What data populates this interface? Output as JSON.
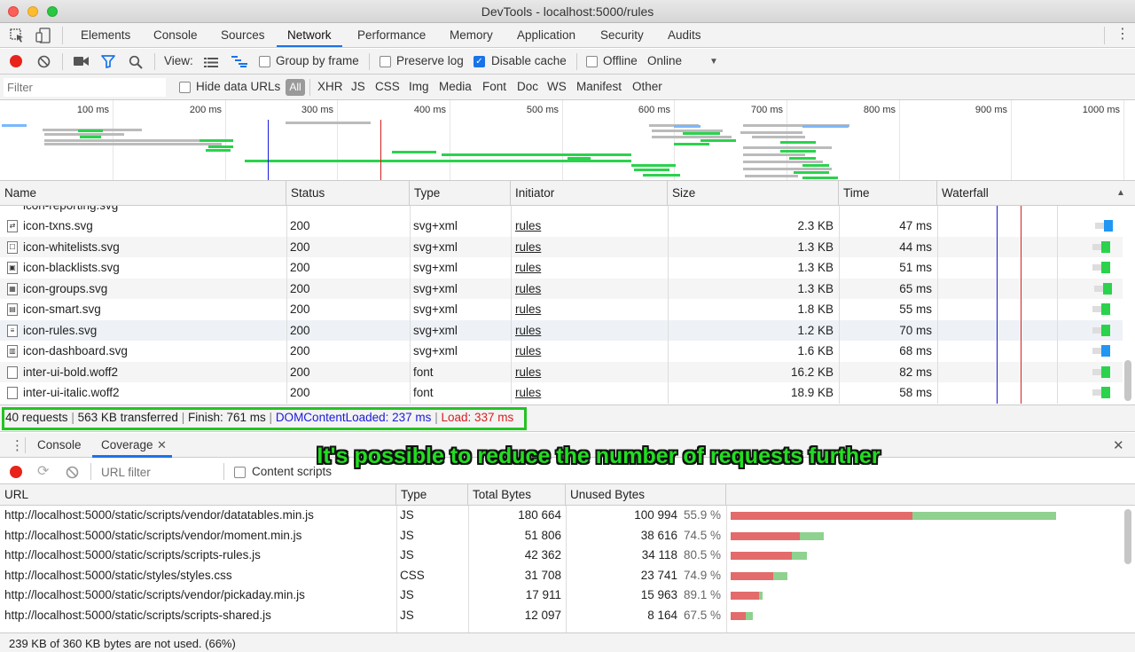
{
  "window": {
    "title": "DevTools - localhost:5000/rules"
  },
  "tabs": [
    "Elements",
    "Console",
    "Sources",
    "Network",
    "Performance",
    "Memory",
    "Application",
    "Security",
    "Audits"
  ],
  "toolbar": {
    "view_label": "View:",
    "group_by_frame": "Group by frame",
    "preserve_log": "Preserve log",
    "disable_cache": "Disable cache",
    "offline": "Offline",
    "throttle_value": "Online"
  },
  "filterbar": {
    "filter_placeholder": "Filter",
    "hide_data_urls": "Hide data URLs",
    "all": "All",
    "types": [
      "XHR",
      "JS",
      "CSS",
      "Img",
      "Media",
      "Font",
      "Doc",
      "WS",
      "Manifest",
      "Other"
    ]
  },
  "overview": {
    "ticks": [
      "100 ms",
      "200 ms",
      "300 ms",
      "400 ms",
      "500 ms",
      "600 ms",
      "700 ms",
      "800 ms",
      "900 ms",
      "1000 ms"
    ]
  },
  "table": {
    "headers": [
      "Name",
      "Status",
      "Type",
      "Initiator",
      "Size",
      "Time",
      "Waterfall"
    ],
    "rows": [
      {
        "name": "icon-txns.svg",
        "status": "200",
        "type": "svg+xml",
        "initiator": "rules",
        "size": "2.3 KB",
        "time": "47 ms"
      },
      {
        "name": "icon-whitelists.svg",
        "status": "200",
        "type": "svg+xml",
        "initiator": "rules",
        "size": "1.3 KB",
        "time": "44 ms"
      },
      {
        "name": "icon-blacklists.svg",
        "status": "200",
        "type": "svg+xml",
        "initiator": "rules",
        "size": "1.3 KB",
        "time": "51 ms"
      },
      {
        "name": "icon-groups.svg",
        "status": "200",
        "type": "svg+xml",
        "initiator": "rules",
        "size": "1.3 KB",
        "time": "65 ms"
      },
      {
        "name": "icon-smart.svg",
        "status": "200",
        "type": "svg+xml",
        "initiator": "rules",
        "size": "1.8 KB",
        "time": "55 ms"
      },
      {
        "name": "icon-rules.svg",
        "status": "200",
        "type": "svg+xml",
        "initiator": "rules",
        "size": "1.2 KB",
        "time": "70 ms"
      },
      {
        "name": "icon-dashboard.svg",
        "status": "200",
        "type": "svg+xml",
        "initiator": "rules",
        "size": "1.6 KB",
        "time": "68 ms"
      },
      {
        "name": "inter-ui-bold.woff2",
        "status": "200",
        "type": "font",
        "initiator": "rules",
        "size": "16.2 KB",
        "time": "82 ms"
      },
      {
        "name": "inter-ui-italic.woff2",
        "status": "200",
        "type": "font",
        "initiator": "rules",
        "size": "18.9 KB",
        "time": "58 ms"
      }
    ]
  },
  "summary": {
    "requests": "40 requests",
    "transferred": "563 KB transferred",
    "finish": "Finish: 761 ms",
    "dcl": "DOMContentLoaded: 237 ms",
    "load": "Load: 337 ms",
    "sep": "|"
  },
  "drawer": {
    "tabs": [
      "Console",
      "Coverage"
    ],
    "url_filter_placeholder": "URL filter",
    "content_scripts": "Content scripts",
    "headers": [
      "URL",
      "Type",
      "Total Bytes",
      "Unused Bytes"
    ],
    "rows": [
      {
        "url": "http://localhost:5000/static/scripts/vendor/datatables.min.js",
        "type": "JS",
        "total": "180 664",
        "unused": "100 994",
        "pct": "55.9 %",
        "total_num": 180664,
        "unused_ratio": 0.559
      },
      {
        "url": "http://localhost:5000/static/scripts/vendor/moment.min.js",
        "type": "JS",
        "total": "51 806",
        "unused": "38 616",
        "pct": "74.5 %",
        "total_num": 51806,
        "unused_ratio": 0.745
      },
      {
        "url": "http://localhost:5000/static/scripts/scripts-rules.js",
        "type": "JS",
        "total": "42 362",
        "unused": "34 118",
        "pct": "80.5 %",
        "total_num": 42362,
        "unused_ratio": 0.805
      },
      {
        "url": "http://localhost:5000/static/styles/styles.css",
        "type": "CSS",
        "total": "31 708",
        "unused": "23 741",
        "pct": "74.9 %",
        "total_num": 31708,
        "unused_ratio": 0.749
      },
      {
        "url": "http://localhost:5000/static/scripts/vendor/pickaday.min.js",
        "type": "JS",
        "total": "17 911",
        "unused": "15 963",
        "pct": "89.1 %",
        "total_num": 17911,
        "unused_ratio": 0.891
      },
      {
        "url": "http://localhost:5000/static/scripts/scripts-shared.js",
        "type": "JS",
        "total": "12 097",
        "unused": "8 164",
        "pct": "67.5 %",
        "total_num": 12097,
        "unused_ratio": 0.675
      }
    ],
    "footer": "239 KB of 360 KB bytes are not used. (66%)"
  },
  "caption": "It's possible to reduce the number of requests further",
  "colors": {
    "accent": "#1a73e8",
    "dcl": "#1a1adb",
    "load": "#d42020",
    "used": "#e36b6b",
    "unused": "#8fd18f",
    "highlight": "#22c422"
  }
}
